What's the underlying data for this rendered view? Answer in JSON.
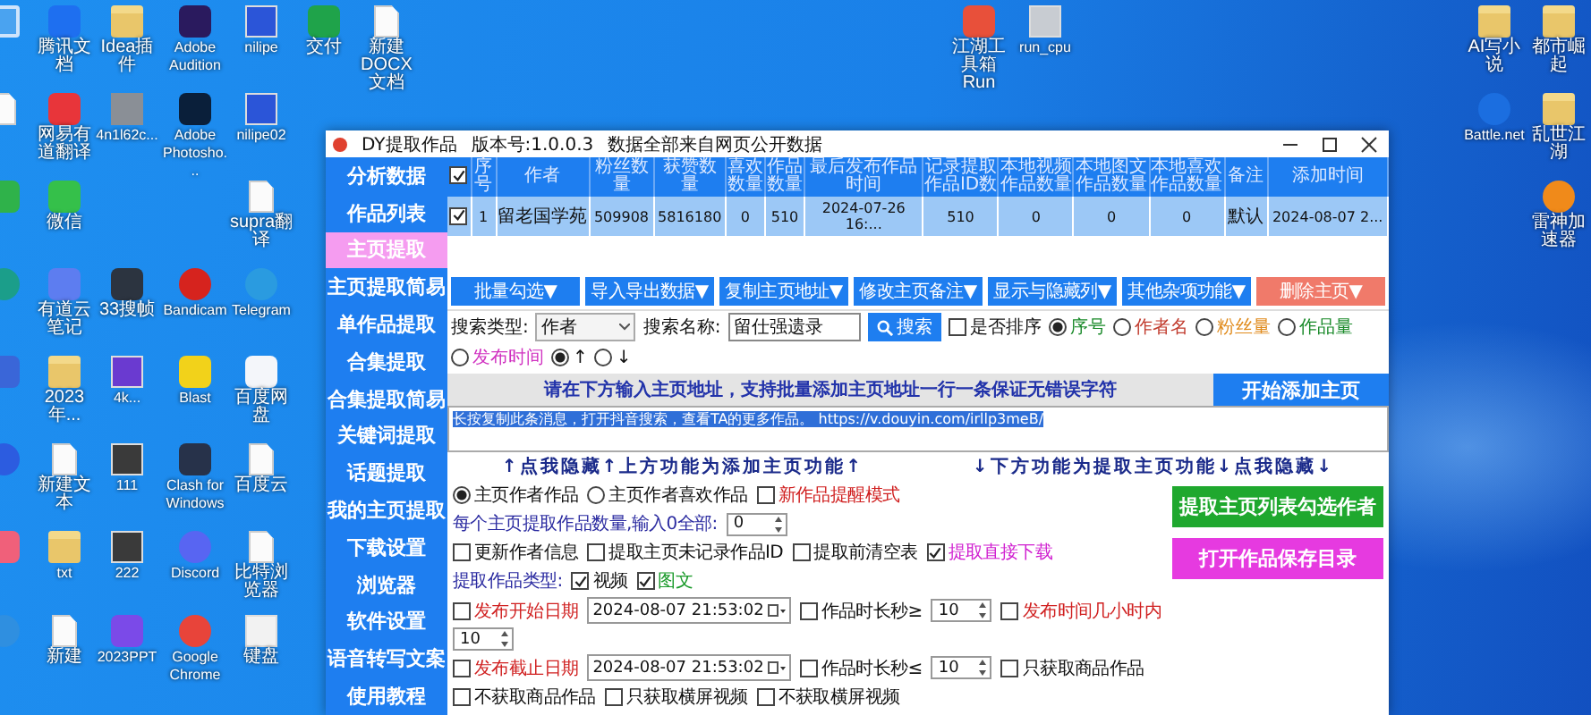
{
  "desktop": {
    "icons": [
      {
        "kind": "window",
        "color": "#4aa3f0"
      },
      {
        "kind": "app",
        "color": "#1e6ff0",
        "label": "腾讯文档"
      },
      {
        "kind": "folder",
        "label": "Idea插件"
      },
      {
        "kind": "app",
        "color": "#2a1a5e",
        "label": "Adobe Audition"
      },
      {
        "kind": "image",
        "color": "#2b55d8",
        "label": "nilipe"
      },
      {
        "kind": "app",
        "color": "#1fa34a",
        "label": "交付"
      },
      {
        "kind": "doc",
        "label": "新建 DOCX 文档"
      },
      {
        "kind": "doc"
      },
      {
        "kind": "app",
        "color": "#e8353a",
        "label": "网易有道翻译"
      },
      {
        "kind": "photo",
        "label": "4n1l62c..."
      },
      {
        "kind": "app",
        "color": "#0a1f3a",
        "label": "Adobe Photosho..."
      },
      {
        "kind": "image",
        "color": "#2b55d8",
        "label": "nilipe02"
      },
      {
        "kind": "app",
        "color": "#2fb24a"
      },
      {
        "kind": "app",
        "color": "#35c04a",
        "label": "微信"
      },
      {
        "kind": "doc",
        "label": "supra翻译"
      },
      {
        "kind": "round",
        "color": "#1b9e8a"
      },
      {
        "kind": "app",
        "color": "#5d7df0",
        "label": "有道云笔记"
      },
      {
        "kind": "app",
        "color": "#2c3440",
        "label": "33搜帧"
      },
      {
        "kind": "round",
        "color": "#d6231e",
        "label": "Bandicam"
      },
      {
        "kind": "round",
        "color": "#2a9be0",
        "label": "Telegram"
      },
      {
        "kind": "app",
        "color": "#3a66d8"
      },
      {
        "kind": "folder",
        "label": "2023年..."
      },
      {
        "kind": "image",
        "color": "#6a3ad0",
        "label": "4k..."
      },
      {
        "kind": "app",
        "color": "#f2d21a",
        "label": "Blast"
      },
      {
        "kind": "app",
        "color": "#f4f6fa",
        "label": "百度网盘"
      },
      {
        "kind": "round",
        "color": "#2c5ce0"
      },
      {
        "kind": "doc",
        "label": "新建文本"
      },
      {
        "kind": "image",
        "color": "#3a3a3a",
        "label": "111"
      },
      {
        "kind": "app",
        "color": "#27324a",
        "label": "Clash for Windows"
      },
      {
        "kind": "doc",
        "label": "百度云"
      },
      {
        "kind": "app",
        "color": "#f0607a"
      },
      {
        "kind": "folder",
        "label": "txt"
      },
      {
        "kind": "image",
        "color": "#3a3a3a",
        "label": "222"
      },
      {
        "kind": "round",
        "color": "#5865f2",
        "label": "Discord"
      },
      {
        "kind": "doc",
        "label": "比特浏览器"
      },
      {
        "kind": "round",
        "color": "#2f8fe0"
      },
      {
        "kind": "doc",
        "label": "新建"
      },
      {
        "kind": "app",
        "color": "#7b4ae8",
        "label": "2023PPT"
      },
      {
        "kind": "round",
        "color": "#e8443a",
        "label": "Google Chrome"
      },
      {
        "kind": "image",
        "color": "#f2f2f2",
        "label": "键盘"
      },
      {
        "kind": "app",
        "color": "#e8503a",
        "label": "江湖工具箱 Run"
      },
      {
        "kind": "image",
        "color": "#c8ccd2",
        "label": "run_cpu"
      },
      {
        "kind": "folder",
        "label": "AI写小说"
      },
      {
        "kind": "folder",
        "label": "都市崛起"
      },
      {
        "kind": "round",
        "color": "#1b6ee0",
        "label": "Battle.net"
      },
      {
        "kind": "folder",
        "label": "乱世江湖"
      },
      {
        "kind": "round",
        "color": "#f08a1a",
        "label": "雷神加速器"
      }
    ]
  },
  "app": {
    "title": "DY提取作品",
    "version": "版本号:1.0.0.3",
    "notice": "数据全部来自网页公开数据",
    "sidebar": {
      "items": [
        {
          "label": "分析数据",
          "selected": false
        },
        {
          "label": "作品列表",
          "selected": false
        },
        {
          "label": "主页提取",
          "selected": true
        },
        {
          "label": "主页提取简易",
          "selected": false
        },
        {
          "label": "单作品提取",
          "selected": false
        },
        {
          "label": "合集提取",
          "selected": false
        },
        {
          "label": "合集提取简易",
          "selected": false
        },
        {
          "label": "关键词提取",
          "selected": false
        },
        {
          "label": "话题提取",
          "selected": false
        },
        {
          "label": "我的主页提取",
          "selected": false
        },
        {
          "label": "下载设置",
          "selected": false
        },
        {
          "label": "浏览器",
          "selected": false
        },
        {
          "label": "软件设置",
          "selected": false
        },
        {
          "label": "语音转写文案",
          "selected": false
        },
        {
          "label": "使用教程",
          "selected": false
        }
      ]
    },
    "table": {
      "header_checked": true,
      "columns": [
        "序号",
        "作者",
        "粉丝数量",
        "获赞数量",
        "喜欢数量",
        "作品数量",
        "最后发布作品时间",
        "记录提取作品ID数",
        "本地视频作品数量",
        "本地图文作品数量",
        "本地喜欢作品数量",
        "备注",
        "添加时间"
      ],
      "rows": [
        {
          "checked": true,
          "selected": true,
          "cells": [
            "1",
            "留老国学苑",
            "509908",
            "5816180",
            "0",
            "510",
            "2024-07-26 16:...",
            "510",
            "0",
            "0",
            "0",
            "默认",
            "2024-08-07 2..."
          ]
        }
      ]
    },
    "toolbar": [
      {
        "label": "批量勾选▼",
        "kind": "normal"
      },
      {
        "label": "导入导出数据▼",
        "kind": "normal"
      },
      {
        "label": "复制主页地址▼",
        "kind": "normal"
      },
      {
        "label": "修改主页备注▼",
        "kind": "normal"
      },
      {
        "label": "显示与隐藏列▼",
        "kind": "normal"
      },
      {
        "label": "其他杂项功能▼",
        "kind": "normal"
      },
      {
        "label": "删除主页▼",
        "kind": "danger"
      }
    ],
    "search": {
      "type_label": "搜索类型:",
      "type_value": "作者",
      "name_label": "搜索名称:",
      "name_value": "留仕强遗录",
      "button": "搜索",
      "sort": {
        "label": "是否排序",
        "checked": false
      },
      "sort_fields": [
        {
          "label": "序号",
          "selected": true,
          "color": "#1a8a2a"
        },
        {
          "label": "作者名",
          "selected": false,
          "color": "#c0392b"
        },
        {
          "label": "粉丝量",
          "selected": false,
          "color": "#e08a1a"
        },
        {
          "label": "作品量",
          "selected": false,
          "color": "#1a8a2a"
        },
        {
          "label": "发布时间",
          "selected": false,
          "color": "#d030c0"
        }
      ],
      "directions": [
        {
          "label": "↑",
          "selected": true
        },
        {
          "label": "↓",
          "selected": false
        }
      ]
    },
    "add_banner": {
      "text": "请在下方输入主页地址，支持批量添加主页地址一行一条保证无错误字符",
      "button": "开始添加主页"
    },
    "input_text": "长按复制此条消息，打开抖音搜索，查看TA的更多作品。 https://v.douyin.com/irllp3meB/",
    "hide_bars": [
      "↑点我隐藏↑上方功能为添加主页功能↑",
      "↓下方功能为提取主页功能↓点我隐藏↓"
    ],
    "option_rows": [
      [
        {
          "kind": "radio",
          "label": "主页作者作品",
          "selected": true
        },
        {
          "kind": "radio",
          "label": "主页作者喜欢作品",
          "selected": false
        },
        {
          "kind": "checkbox",
          "label": "新作品提醒模式",
          "checked": false,
          "color": "#d02020"
        },
        {
          "kind": "text",
          "label": "每个主页提取作品数量,输入0全部:",
          "color": "#2a2aa0"
        },
        {
          "kind": "number",
          "value": "0"
        }
      ],
      [
        {
          "kind": "checkbox",
          "label": "更新作者信息",
          "checked": false
        },
        {
          "kind": "checkbox",
          "label": "提取主页未记录作品ID",
          "checked": false
        },
        {
          "kind": "checkbox",
          "label": "提取前清空表",
          "checked": false
        },
        {
          "kind": "checkbox",
          "label": "提取直接下载",
          "checked": true,
          "color": "#d020d0"
        },
        {
          "kind": "text",
          "label": "提取作品类型:",
          "color": "#2a2aa0"
        },
        {
          "kind": "checkbox",
          "label": "视频",
          "checked": true
        },
        {
          "kind": "checkbox",
          "label": "图文",
          "checked": true,
          "color": "#1a9a2a"
        }
      ],
      [
        {
          "kind": "checkbox",
          "label": "发布开始日期",
          "checked": false,
          "color": "#d02020"
        },
        {
          "kind": "date",
          "value": "2024-08-07 21:53:02"
        },
        {
          "kind": "checkbox",
          "label": "作品时长秒≥",
          "checked": false
        },
        {
          "kind": "number",
          "value": "10"
        },
        {
          "kind": "checkbox",
          "label": "发布时间几小时内",
          "checked": false,
          "color": "#d02020"
        },
        {
          "kind": "number",
          "value": "10"
        }
      ],
      [
        {
          "kind": "checkbox",
          "label": "发布截止日期",
          "checked": false,
          "color": "#d02020"
        },
        {
          "kind": "date",
          "value": "2024-08-07 21:53:02"
        },
        {
          "kind": "checkbox",
          "label": "作品时长秒≤",
          "checked": false
        },
        {
          "kind": "number",
          "value": "10"
        },
        {
          "kind": "checkbox",
          "label": "只获取商品作品",
          "checked": false
        },
        {
          "kind": "checkbox",
          "label": "不获取商品作品",
          "checked": false
        },
        {
          "kind": "checkbox",
          "label": "只获取横屏视频",
          "checked": false
        },
        {
          "kind": "checkbox",
          "label": "不获取横屏视频",
          "checked": false
        }
      ]
    ],
    "action_buttons": [
      {
        "label": "提取主页列表勾选作者",
        "color": "#1fa82e"
      },
      {
        "label": "打开作品保存目录",
        "color": "#e63ae0"
      }
    ]
  }
}
